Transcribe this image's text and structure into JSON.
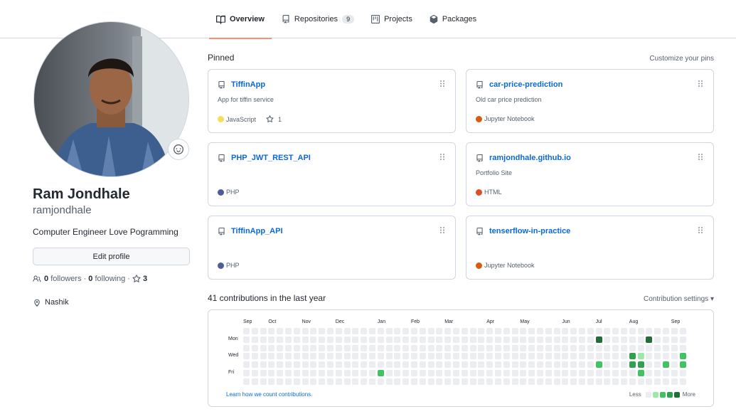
{
  "tabs": [
    {
      "label": "Overview",
      "icon": "book-icon",
      "active": true
    },
    {
      "label": "Repositories",
      "icon": "repo-icon",
      "count": "9"
    },
    {
      "label": "Projects",
      "icon": "project-icon"
    },
    {
      "label": "Packages",
      "icon": "package-icon"
    }
  ],
  "profile": {
    "full_name": "Ram Jondhale",
    "username": "ramjondhale",
    "bio": "Computer Engineer Love Pogramming",
    "edit_label": "Edit profile",
    "followers_count": "0",
    "followers_label": "followers",
    "following_count": "0",
    "following_label": "following",
    "stars_count": "3",
    "location": "Nashik"
  },
  "pinned": {
    "title": "Pinned",
    "customize_label": "Customize your pins",
    "cards": [
      {
        "name": "TiffinApp",
        "description": "App for tiffin service",
        "language": "JavaScript",
        "lang_color": "#f1e05a",
        "stars": "1"
      },
      {
        "name": "car-price-prediction",
        "description": "Old car price prediction",
        "language": "Jupyter Notebook",
        "lang_color": "#da5b0b"
      },
      {
        "name": "PHP_JWT_REST_API",
        "description": "",
        "language": "PHP",
        "lang_color": "#4f5d95"
      },
      {
        "name": "ramjondhale.github.io",
        "description": "Portfolio Site",
        "language": "HTML",
        "lang_color": "#e34c26"
      },
      {
        "name": "TiffinApp_API",
        "description": "",
        "language": "PHP",
        "lang_color": "#4f5d95"
      },
      {
        "name": "tenserflow-in-practice",
        "description": "",
        "language": "Jupyter Notebook",
        "lang_color": "#da5b0b"
      }
    ]
  },
  "contributions": {
    "title": "41 contributions in the last year",
    "settings_label": "Contribution settings",
    "months": [
      "Sep",
      "Oct",
      "Nov",
      "Dec",
      "Jan",
      "Feb",
      "Mar",
      "Apr",
      "May",
      "Jun",
      "Jul",
      "Aug",
      "Sep"
    ],
    "day_labels": [
      "Mon",
      "Wed",
      "Fri"
    ],
    "learn_label": "Learn how we count contributions.",
    "less_label": "Less",
    "more_label": "More",
    "level_colors": [
      "#ebedf0",
      "#9be9a8",
      "#40c463",
      "#30a14e",
      "#216e39"
    ],
    "active_cells": [
      {
        "week": 16,
        "day": 5,
        "level": 2
      },
      {
        "week": 42,
        "day": 1,
        "level": 4
      },
      {
        "week": 42,
        "day": 4,
        "level": 2
      },
      {
        "week": 46,
        "day": 3,
        "level": 3
      },
      {
        "week": 46,
        "day": 4,
        "level": 3
      },
      {
        "week": 47,
        "day": 3,
        "level": 1
      },
      {
        "week": 47,
        "day": 4,
        "level": 3
      },
      {
        "week": 47,
        "day": 5,
        "level": 2
      },
      {
        "week": 48,
        "day": 1,
        "level": 4
      },
      {
        "week": 50,
        "day": 4,
        "level": 2
      },
      {
        "week": 52,
        "day": 3,
        "level": 2
      },
      {
        "week": 52,
        "day": 4,
        "level": 2
      }
    ]
  }
}
